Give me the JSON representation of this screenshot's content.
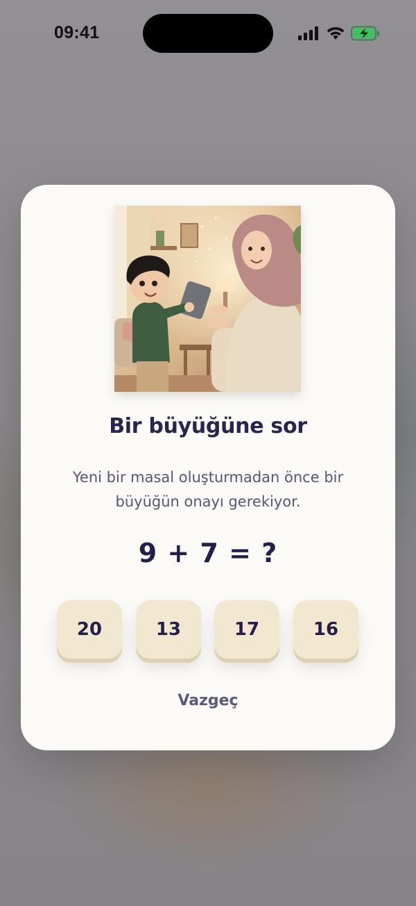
{
  "status_bar": {
    "time": "09:41",
    "icons": [
      "signal-icon",
      "wifi-icon",
      "battery-charging-icon"
    ],
    "battery_color": "#34c759"
  },
  "dialog": {
    "image": "parent-child-illustration",
    "title": "Bir büyüğüne sor",
    "message": "Yeni bir masal oluşturmadan önce bir büyüğün onayı gerekiyor.",
    "question": "9 + 7 = ?",
    "answers": [
      "20",
      "13",
      "17",
      "16"
    ],
    "cancel_label": "Vazgeç"
  },
  "colors": {
    "title": "#2b2350",
    "message": "#5a5478",
    "answer_bg": "#f2e8d0",
    "modal_bg": "#fbfaf6"
  }
}
